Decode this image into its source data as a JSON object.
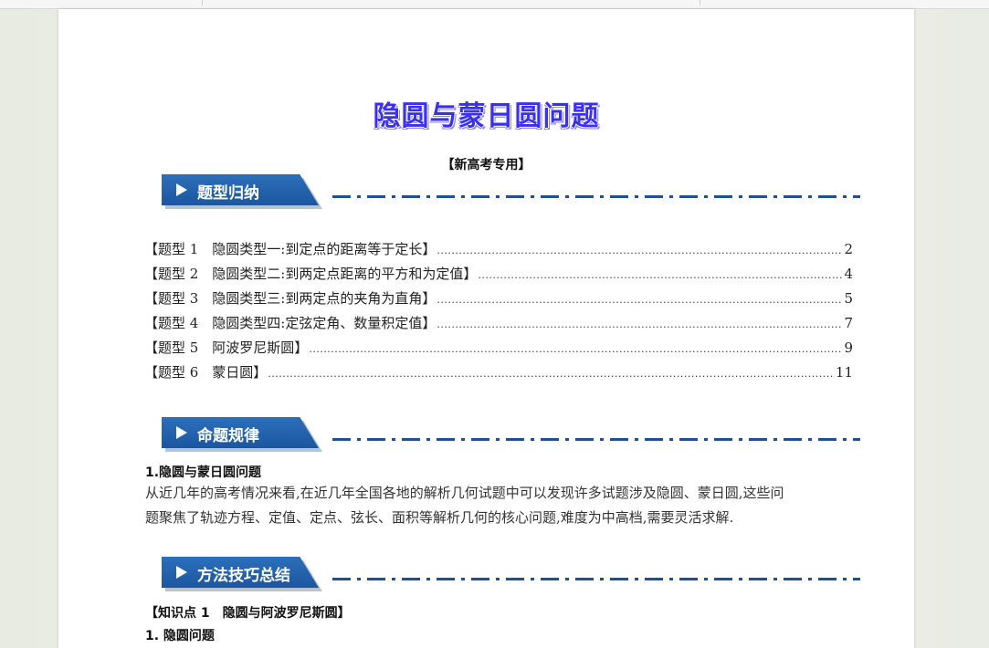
{
  "document": {
    "title": "隐圆与蒙日圆问题",
    "subtitle": "【新高考专用】",
    "sections": {
      "types": "题型归纳",
      "rules": "命题规律",
      "methods": "方法技巧总结"
    },
    "toc": [
      {
        "label": "【题型 1　隐圆类型一:到定点的距离等于定长】",
        "page": "2"
      },
      {
        "label": "【题型 2　隐圆类型二:到两定点距离的平方和为定值】",
        "page": "4"
      },
      {
        "label": "【题型 3　隐圆类型三:到两定点的夹角为直角】",
        "page": "5"
      },
      {
        "label": "【题型 4　隐圆类型四:定弦定角、数量积定值】",
        "page": "7"
      },
      {
        "label": "【题型 5　阿波罗尼斯圆】",
        "page": "9"
      },
      {
        "label": "【题型 6　蒙日圆】",
        "page": "11"
      }
    ],
    "rules_heading": "1.隐圆与蒙日圆问题",
    "rules_line1": "从近几年的高考情况来看,在近几年全国各地的解析几何试题中可以发现许多试题涉及隐圆、蒙日圆,这些问",
    "rules_line2": "题聚焦了轨迹方程、定值、定点、弦长、面积等解析几何的核心问题,难度为中高档,需要灵活求解.",
    "knowledge_heading": "【知识点 1　隐圆与阿波罗尼斯圆】",
    "cut_heading": "1. 隐圆问题"
  }
}
